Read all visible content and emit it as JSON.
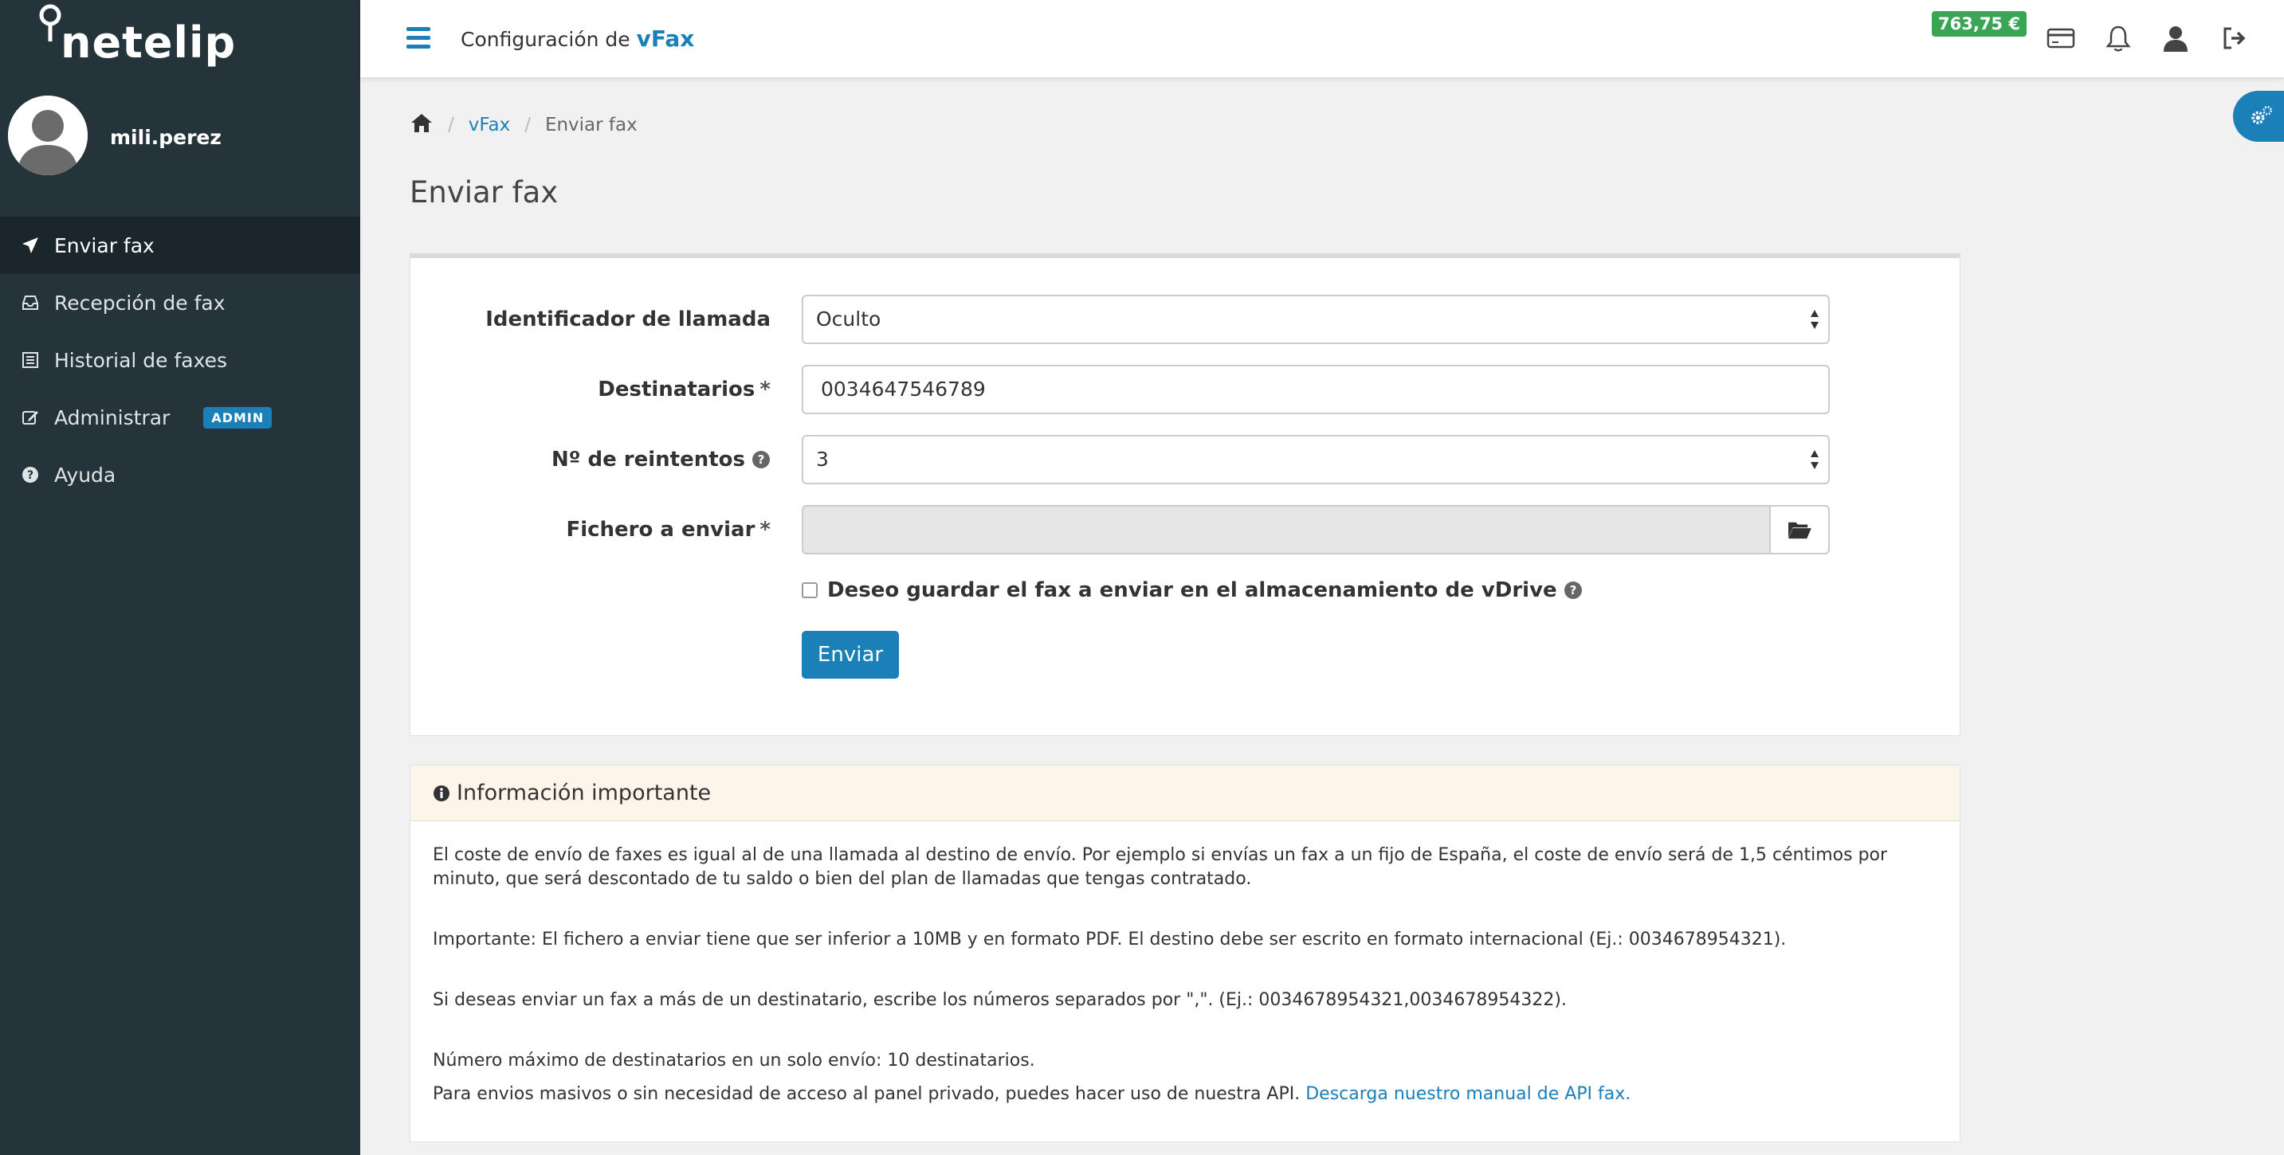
{
  "brand": {
    "name": "netelip"
  },
  "user": {
    "name": "mili.perez"
  },
  "sidebar": {
    "items": [
      {
        "label": "Enviar fax",
        "icon": "paper-plane-icon",
        "active": true
      },
      {
        "label": "Recepción de fax",
        "icon": "inbox-icon"
      },
      {
        "label": "Historial de faxes",
        "icon": "list-icon"
      },
      {
        "label": "Administrar",
        "icon": "edit-icon",
        "badge": "ADMIN"
      },
      {
        "label": "Ayuda",
        "icon": "question-circle-icon"
      }
    ]
  },
  "topbar": {
    "title_prefix": "Configuración de",
    "title_product": "vFax",
    "balance": "763,75 €"
  },
  "breadcrumb": {
    "level1": "vFax",
    "level2": "Enviar fax"
  },
  "page": {
    "title": "Enviar fax"
  },
  "form": {
    "caller_id_label": "Identificador de llamada",
    "caller_id_value": "Oculto",
    "recipients_label": "Destinatarios",
    "recipients_value": "0034647546789",
    "retries_label": "Nº de reintentos",
    "retries_value": "3",
    "file_label": "Fichero a enviar",
    "required_mark": "*",
    "save_vdrive_label": "Deseo guardar el fax a enviar en el almacenamiento de vDrive",
    "submit_label": "Enviar"
  },
  "info": {
    "title": "Información importante",
    "p1": "El coste de envío de faxes es igual al de una llamada al destino de envío. Por ejemplo si envías un fax a un fijo de España, el coste de envío será de 1,5 céntimos por minuto, que será descontado de tu saldo o bien del plan de llamadas que tengas contratado.",
    "p2": "Importante: El fichero a enviar tiene que ser inferior a 10MB y en formato PDF. El destino debe ser escrito en formato internacional (Ej.: 0034678954321).",
    "p3": "Si deseas enviar un fax a más de un destinatario, escribe los números separados por \",\". (Ej.: 0034678954321,0034678954322).",
    "p4": "Número máximo de destinatarios en un solo envío: 10 destinatarios.",
    "p5": "Para envios masivos o sin necesidad de acceso al panel privado, puedes hacer uso de nuestra API.",
    "p5_link": "Descarga nuestro manual de API fax."
  },
  "colors": {
    "sidebar": "#25343a",
    "accent": "#1b7fb8",
    "balance": "#3aa655"
  }
}
